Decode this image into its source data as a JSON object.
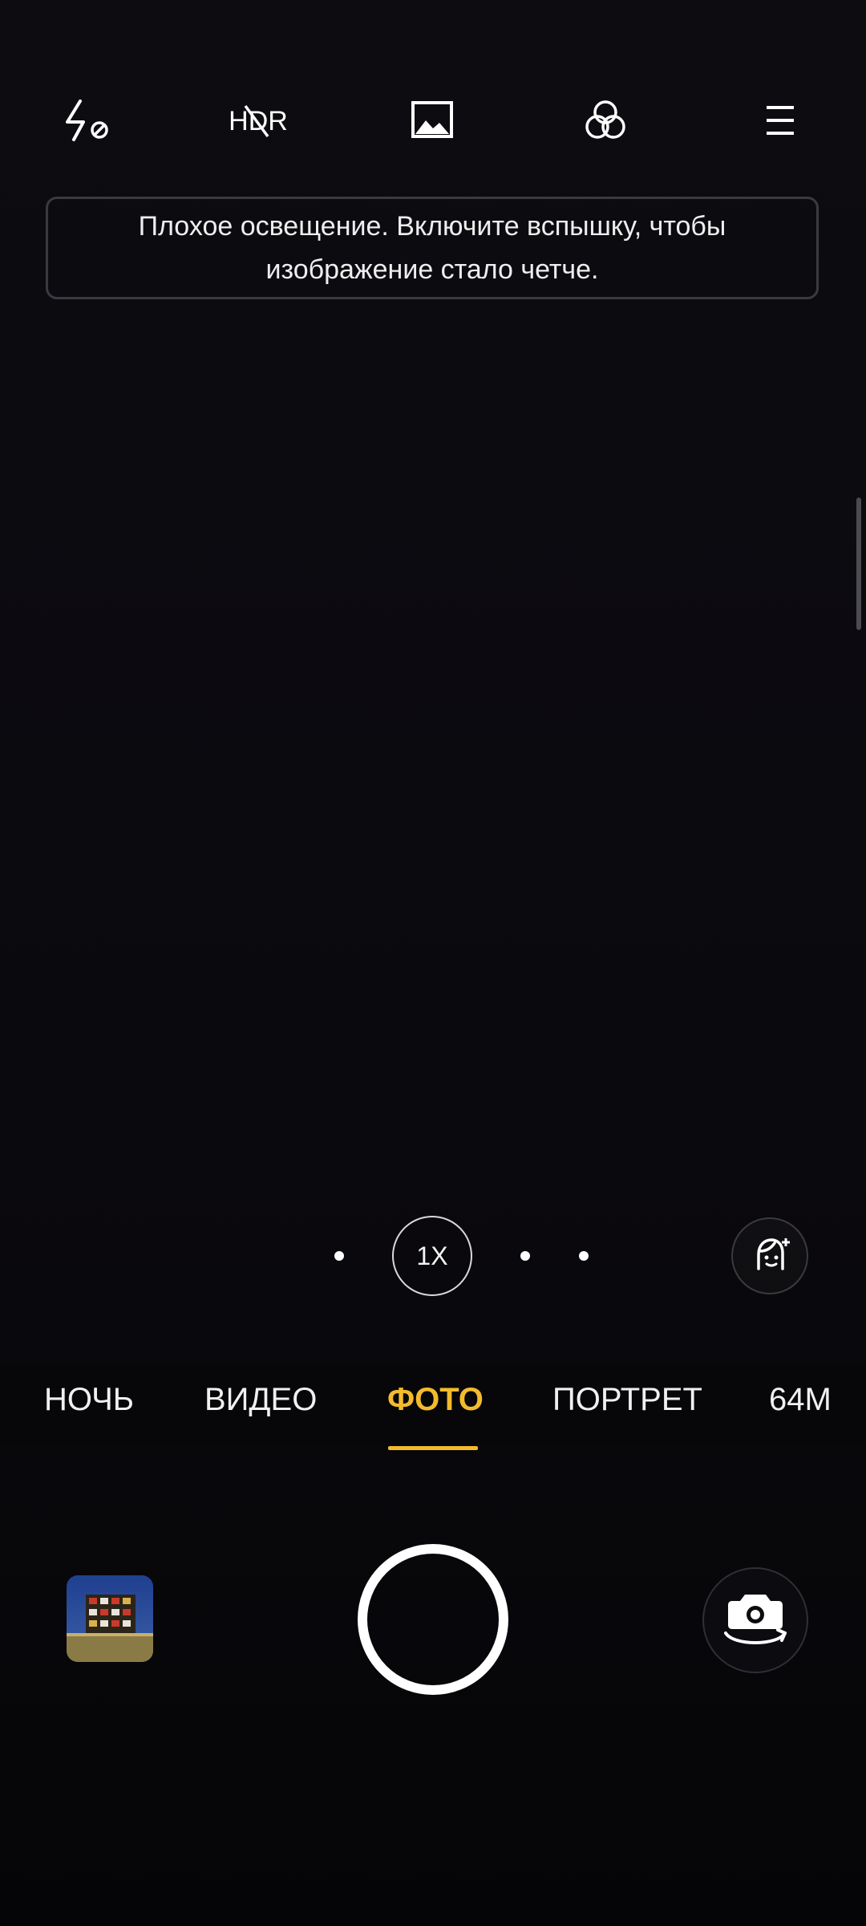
{
  "top_bar": {
    "icons": [
      {
        "name": "flash-off-icon"
      },
      {
        "name": "hdr-off-icon",
        "label": "HDR"
      },
      {
        "name": "image-ratio-icon"
      },
      {
        "name": "filters-icon"
      },
      {
        "name": "menu-icon"
      }
    ]
  },
  "hint": {
    "text": "Плохое освещение. Включите вспышку, чтобы изображение стало четче."
  },
  "zoom": {
    "label": "1X"
  },
  "modes": {
    "items": [
      "НОЧЬ",
      "ВИДЕО",
      "ФОТО",
      "ПОРТРЕТ",
      "64M"
    ],
    "selected": "ФОТО"
  },
  "controls": {
    "gallery_icon": "gallery-thumbnail",
    "shutter_icon": "shutter-button",
    "switch_icon": "switch-camera-icon"
  },
  "colors": {
    "accent": "#f3bb2c",
    "background": "#0b0a0f",
    "text": "#f2f2f2"
  }
}
